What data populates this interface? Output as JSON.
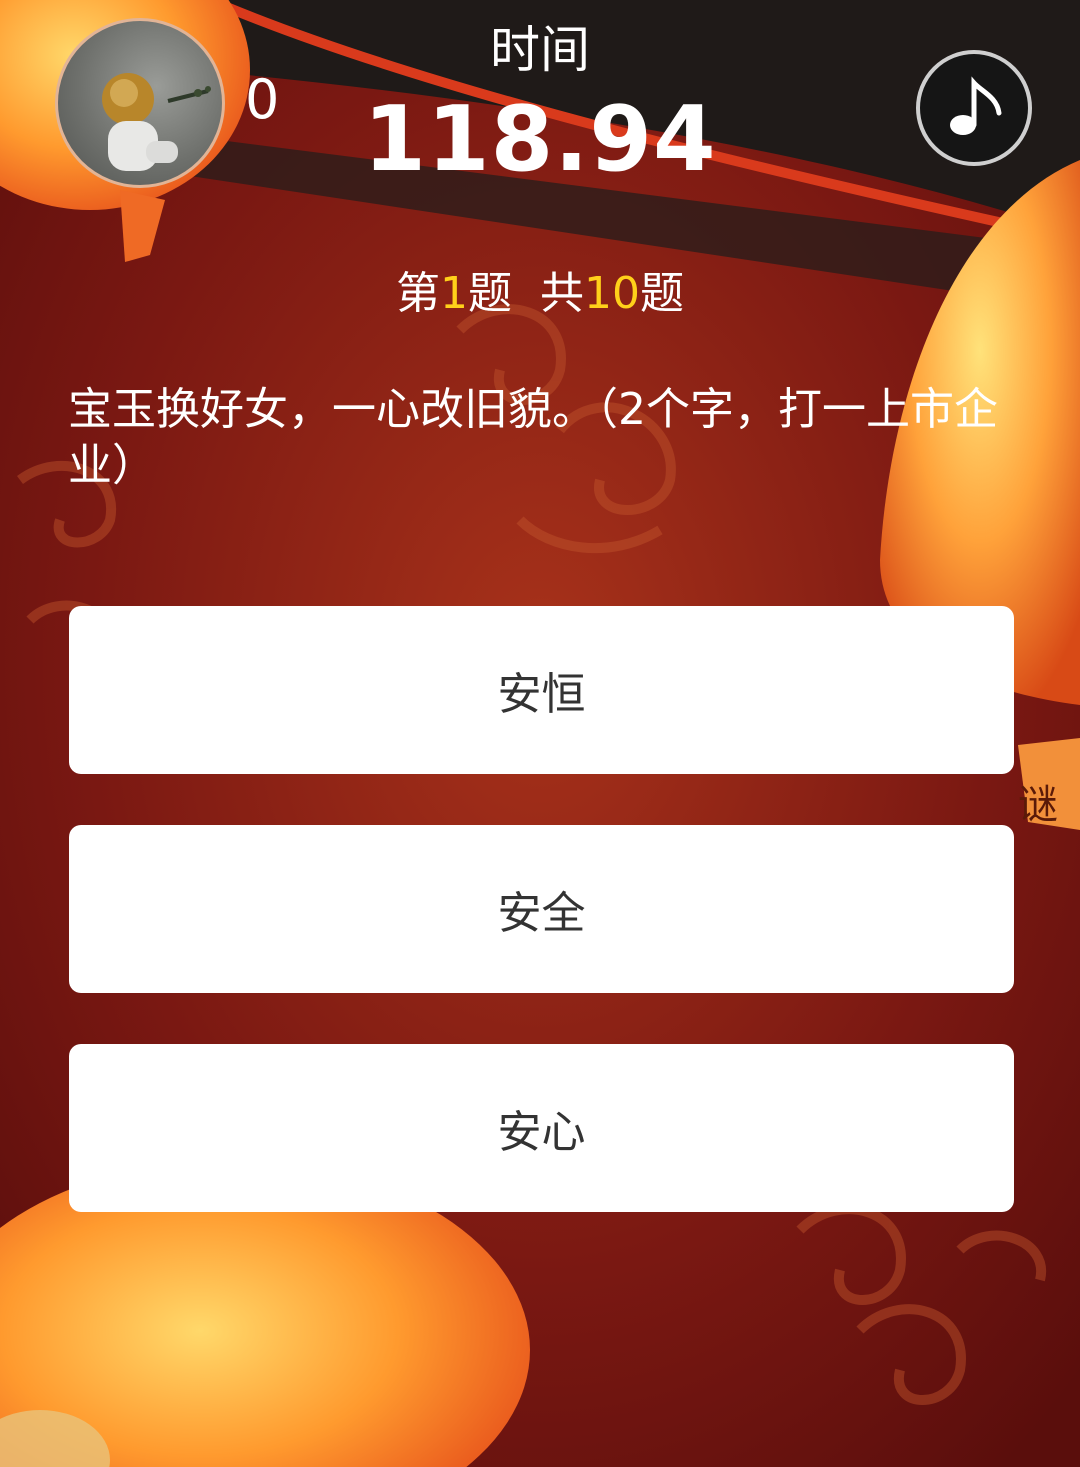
{
  "header": {
    "avatar_alt": "avatar",
    "score": "0",
    "time_label": "时间",
    "time_value": "118.94",
    "music_icon": "music-note-icon"
  },
  "progress": {
    "prefix": "第",
    "current": "1",
    "mid": "题  共",
    "total": "10",
    "suffix": "题"
  },
  "question": {
    "text": "宝玉换好女，一心改旧貌。（2个字，打一上市企业）"
  },
  "options": [
    {
      "label": "安恒"
    },
    {
      "label": "安全"
    },
    {
      "label": "安心"
    }
  ],
  "decor": {
    "lantern_tag": "谜"
  },
  "colors": {
    "background": "#6e1310",
    "highlight": "#ffd11a",
    "lantern": "#f47a28"
  }
}
